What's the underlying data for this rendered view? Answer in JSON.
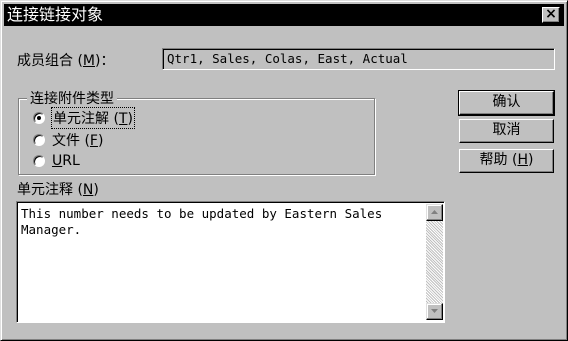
{
  "window": {
    "title": "连接链接对象",
    "close_glyph": "×"
  },
  "member": {
    "label_prefix": "成员组合 (",
    "label_hotkey": "M",
    "label_suffix": ")：",
    "value": "Qtr1, Sales, Colas, East, Actual"
  },
  "link_type": {
    "group_title": "连接附件类型",
    "options": [
      {
        "label": "单元注解",
        "hotkey": "T",
        "checked": true
      },
      {
        "label": "文件",
        "hotkey": "F",
        "checked": false
      },
      {
        "label": "URL",
        "hotkey": "U",
        "checked": false
      }
    ]
  },
  "buttons": {
    "ok": "确认",
    "cancel": "取消",
    "help_prefix": "帮助 (",
    "help_hotkey": "H",
    "help_suffix": ")"
  },
  "note": {
    "label_prefix": "单元注释 (",
    "label_hotkey": "N",
    "label_suffix": ")",
    "text": "This number needs to be updated by Eastern Sales\nManager."
  },
  "icons": {
    "close": "close-icon",
    "scroll_up": "scroll-up-arrow-icon",
    "scroll_down": "scroll-down-arrow-icon"
  }
}
